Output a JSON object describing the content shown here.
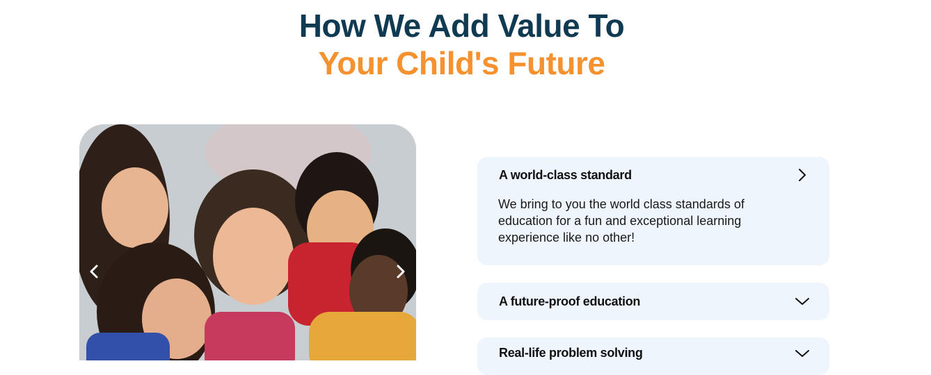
{
  "heading": {
    "line1": "How We Add Value To",
    "line2": "Your Child's Future"
  },
  "carousel": {
    "image_alt": "Children looking at a tablet together",
    "prev_icon": "chevron-left-icon",
    "next_icon": "chevron-right-icon"
  },
  "accordion": [
    {
      "title": "A world-class standard",
      "body": "We bring to you the world class standards of education for a fun and exceptional learning experience like no other!",
      "expanded": true,
      "icon": "chevron-right-icon"
    },
    {
      "title": "A future-proof education",
      "expanded": false,
      "icon": "chevron-down-icon"
    },
    {
      "title": "Real-life problem solving",
      "expanded": false,
      "icon": "chevron-down-icon"
    }
  ],
  "colors": {
    "heading_dark": "#0f3a52",
    "heading_accent": "#f5912f",
    "accordion_bg": "#eef5fd"
  }
}
